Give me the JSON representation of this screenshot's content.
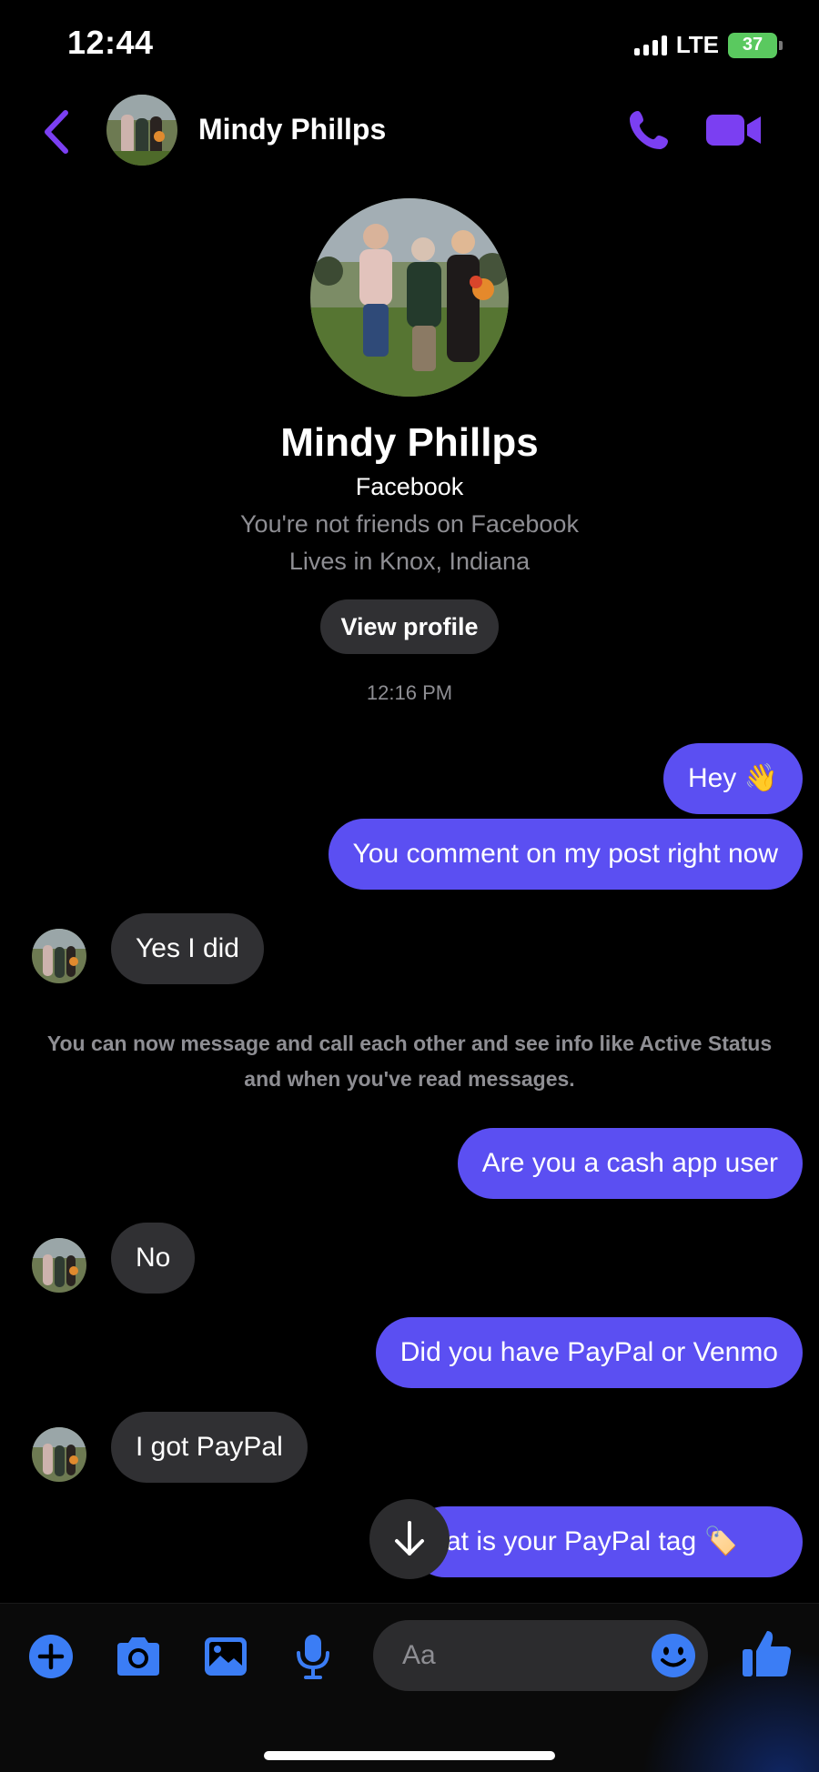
{
  "status_bar": {
    "time": "12:44",
    "network": "LTE",
    "battery": "37"
  },
  "header": {
    "contact_name": "Mindy Phillps"
  },
  "profile": {
    "name": "Mindy Phillps",
    "source": "Facebook",
    "friend_status": "You're not friends on Facebook",
    "location": "Lives in Knox, Indiana",
    "view_profile_label": "View profile"
  },
  "thread": {
    "timestamp": "12:16 PM",
    "notice": "You can now message and call each other and see info like Active Status and when you've read messages.",
    "messages": [
      {
        "direction": "out",
        "text": "Hey 👋"
      },
      {
        "direction": "out",
        "text": "You comment on my post right now"
      },
      {
        "direction": "in",
        "text": "Yes I did"
      },
      {
        "direction": "out",
        "text": "Are you a cash app user"
      },
      {
        "direction": "in",
        "text": "No"
      },
      {
        "direction": "out",
        "text": "Did you have PayPal or Venmo"
      },
      {
        "direction": "in",
        "text": "I got PayPal"
      },
      {
        "direction": "out",
        "text": "at is your PayPal tag 🏷️"
      }
    ]
  },
  "composer": {
    "placeholder": "Aa"
  },
  "icons": {
    "back": "chevron-left-icon",
    "call": "phone-icon",
    "video": "video-camera-icon",
    "add": "plus-circle-icon",
    "camera": "camera-icon",
    "gallery": "image-icon",
    "mic": "microphone-icon",
    "emoji": "smiley-icon",
    "like": "thumbs-up-icon",
    "scroll": "arrow-down-icon"
  },
  "colors": {
    "accent_purple": "#7b3ff2",
    "outgoing_bubble": "#5b4ff2",
    "incoming_bubble": "#303033",
    "composer_blue": "#3b7df5"
  }
}
